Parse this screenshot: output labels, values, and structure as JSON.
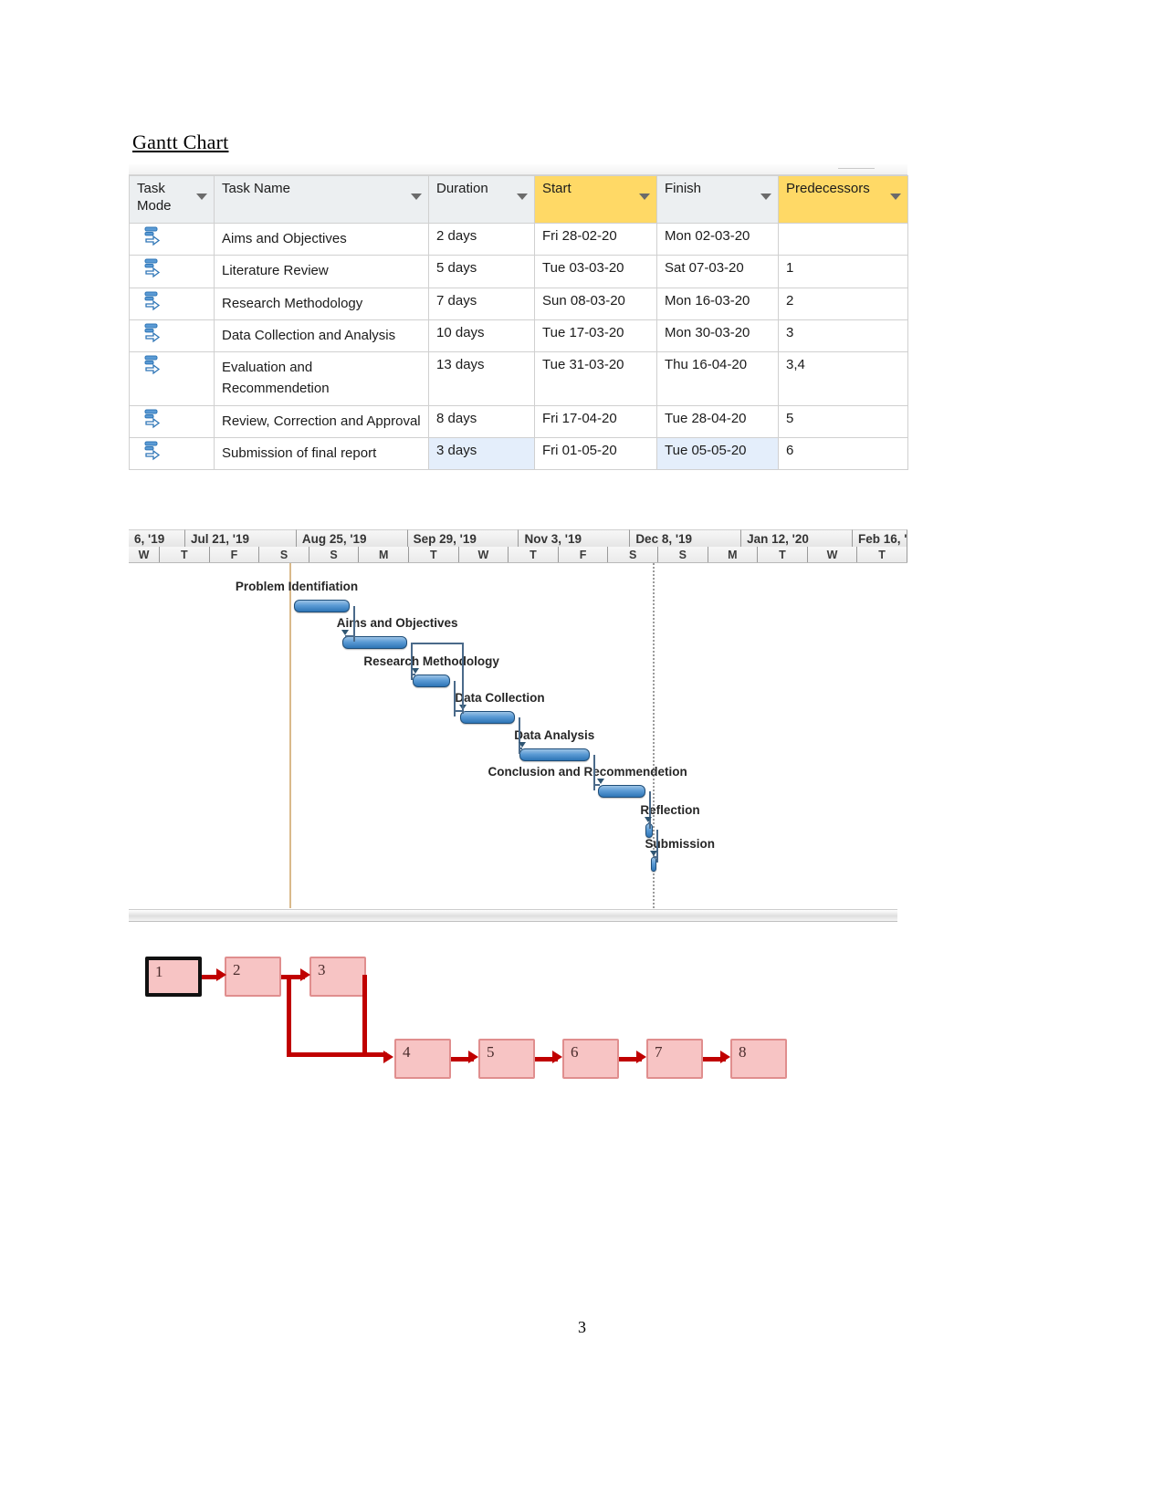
{
  "document": {
    "heading": "Gantt Chart",
    "page_number": "3"
  },
  "task_table": {
    "columns": [
      {
        "label": "Task Mode",
        "highlighted": false
      },
      {
        "label": "Task Name",
        "highlighted": false
      },
      {
        "label": "Duration",
        "highlighted": false
      },
      {
        "label": "Start",
        "highlighted": true
      },
      {
        "label": "Finish",
        "highlighted": false
      },
      {
        "label": "Predecessors",
        "highlighted": true
      }
    ],
    "rows": [
      {
        "mode_icon": "auto-schedule-icon",
        "name": "Aims and Objectives",
        "duration": "2 days",
        "start": "Fri 28-02-20",
        "finish": "Mon 02-03-20",
        "predecessors": ""
      },
      {
        "mode_icon": "auto-schedule-icon",
        "name": "Literature Review",
        "duration": "5 days",
        "start": "Tue 03-03-20",
        "finish": "Sat 07-03-20",
        "predecessors": "1"
      },
      {
        "mode_icon": "auto-schedule-icon",
        "name": "Research Methodology",
        "duration": "7 days",
        "start": "Sun 08-03-20",
        "finish": "Mon 16-03-20",
        "predecessors": "2"
      },
      {
        "mode_icon": "auto-schedule-icon",
        "name": "Data Collection and Analysis",
        "duration": "10 days",
        "start": "Tue 17-03-20",
        "finish": "Mon 30-03-20",
        "predecessors": "3"
      },
      {
        "mode_icon": "auto-schedule-icon",
        "name": "Evaluation and Recommendetion",
        "duration": "13 days",
        "start": "Tue 31-03-20",
        "finish": "Thu 16-04-20",
        "predecessors": "3,4"
      },
      {
        "mode_icon": "auto-schedule-icon",
        "name": "Review, Correction and Approval",
        "duration": "8 days",
        "start": "Fri 17-04-20",
        "finish": "Tue 28-04-20",
        "predecessors": "5"
      },
      {
        "mode_icon": "auto-schedule-icon",
        "name": "Submission of final report",
        "duration": "3 days",
        "start": "Fri 01-05-20",
        "finish": "Tue 05-05-20",
        "predecessors": "6"
      }
    ]
  },
  "chart_data": {
    "type": "bar",
    "title": "Gantt Chart",
    "timeline_major_labels": [
      "6, '19",
      "Jul 21, '19",
      "Aug 25, '19",
      "Sep 29, '19",
      "Nov 3, '19",
      "Dec 8, '19",
      "Jan 12, '20",
      "Feb 16, '"
    ],
    "timeline_minor_labels": [
      "W",
      "T",
      "F",
      "S",
      "S",
      "M",
      "T",
      "W",
      "T",
      "F",
      "S",
      "S",
      "M",
      "T",
      "W",
      "T"
    ],
    "categories": [
      "Problem Identifiation",
      "Aims and Objectives",
      "Research Methodology",
      "Data Collection",
      "Data Analysis",
      "Conclusion and Recommendetion",
      "Reflection",
      "Submission"
    ],
    "bars": [
      {
        "label": "Problem Identifiation",
        "left_pct": 21.2,
        "width_pct": 7.2
      },
      {
        "label": "Aims and Objectives",
        "left_pct": 27.4,
        "width_pct": 8.4
      },
      {
        "label": "Research Methodology",
        "left_pct": 36.5,
        "width_pct": 4.8
      },
      {
        "label": "Data Collection",
        "left_pct": 42.6,
        "width_pct": 7.0
      },
      {
        "label": "Data Analysis",
        "left_pct": 50.2,
        "width_pct": 9.0
      },
      {
        "label": "Conclusion and Recommendetion",
        "left_pct": 60.2,
        "width_pct": 6.2
      },
      {
        "label": "Reflection",
        "left_pct": 66.4,
        "width_pct": 0.9
      },
      {
        "label": "Submission",
        "left_pct": 67.0,
        "width_pct": 0.8
      }
    ],
    "xlabel": "",
    "ylabel": "",
    "grid": false,
    "legend": "none"
  },
  "network_diagram": {
    "type": "precedence-network",
    "nodes": [
      {
        "id": "1",
        "critical": true
      },
      {
        "id": "2",
        "critical": false
      },
      {
        "id": "3",
        "critical": false
      },
      {
        "id": "4",
        "critical": false
      },
      {
        "id": "5",
        "critical": false
      },
      {
        "id": "6",
        "critical": false
      },
      {
        "id": "7",
        "critical": false
      },
      {
        "id": "8",
        "critical": false
      }
    ],
    "edges": [
      {
        "from": "1",
        "to": "2"
      },
      {
        "from": "2",
        "to": "3"
      },
      {
        "from": "2",
        "to": "4"
      },
      {
        "from": "3",
        "to": "4"
      },
      {
        "from": "4",
        "to": "5"
      },
      {
        "from": "5",
        "to": "6"
      },
      {
        "from": "6",
        "to": "7"
      },
      {
        "from": "7",
        "to": "8"
      }
    ],
    "colors": {
      "node_fill": "#f7c4c4",
      "node_border": "#e08e8e",
      "link": "#c00000",
      "critical_border": "#111111"
    }
  }
}
